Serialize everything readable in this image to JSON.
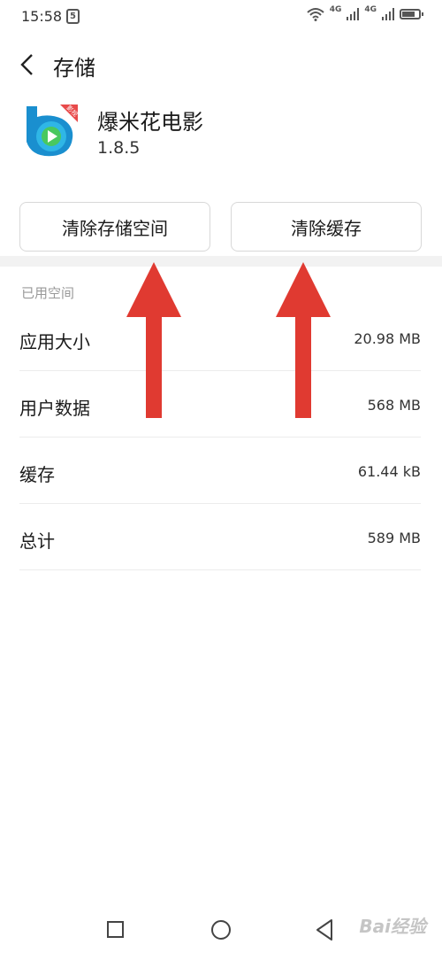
{
  "status_bar": {
    "time": "15:58",
    "badge_label": "5",
    "net1": "4G",
    "net2": "4G",
    "battery_level": 0.8,
    "icons": [
      "html5-icon",
      "wifi-icon",
      "signal-icon",
      "battery-icon"
    ]
  },
  "header": {
    "title": "存储",
    "back_icon": "chevron-left-icon"
  },
  "app": {
    "name": "爆米花电影",
    "version": "1.8.5",
    "icon_badge": "影视",
    "icon_name": "play-icon"
  },
  "actions": {
    "clear_storage": "清除存储空间",
    "clear_cache": "清除缓存"
  },
  "section": {
    "label": "已用空间",
    "rows": [
      {
        "label": "应用大小",
        "value": "20.98 MB"
      },
      {
        "label": "用户数据",
        "value": "568 MB"
      },
      {
        "label": "缓存",
        "value": "61.44 kB"
      },
      {
        "label": "总计",
        "value": "589 MB"
      }
    ]
  },
  "annotation": {
    "arrow_color": "#e03a31"
  },
  "bottom_nav": {
    "icons": [
      "recent-apps-icon",
      "home-icon",
      "back-icon"
    ],
    "watermark": "Bai经验"
  }
}
